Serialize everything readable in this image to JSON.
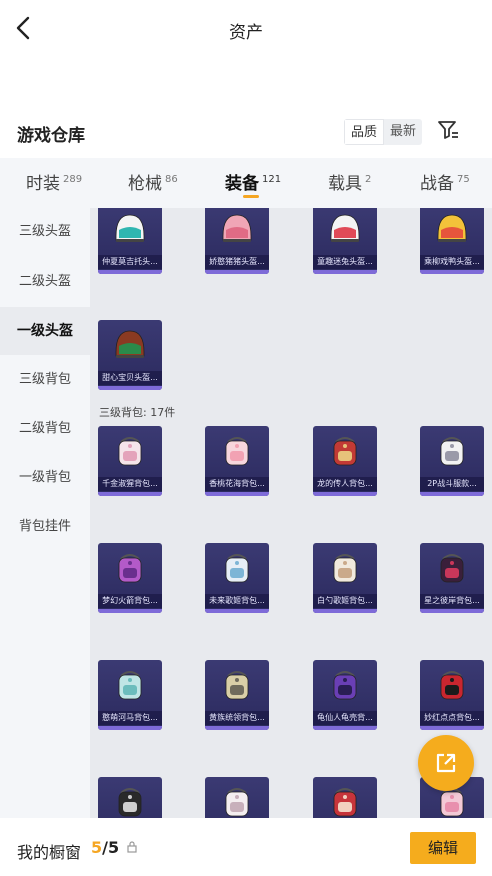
{
  "header": {
    "title": "资产"
  },
  "warehouse": {
    "title": "游戏仓库",
    "sort_options": [
      "品质",
      "最新"
    ]
  },
  "tabs": [
    {
      "label": "时装",
      "count": "289"
    },
    {
      "label": "枪械",
      "count": "86"
    },
    {
      "label": "装备",
      "count": "121"
    },
    {
      "label": "载具",
      "count": "2"
    },
    {
      "label": "战备",
      "count": "75"
    }
  ],
  "sidebar": {
    "items": [
      "三级头盔",
      "二级头盔",
      "一级头盔",
      "三级背包",
      "二级背包",
      "一级背包",
      "背包挂件"
    ]
  },
  "content": {
    "helmets": [
      {
        "name": "仲夏莫吉托头...",
        "icon": "helmet-mint-icon"
      },
      {
        "name": "娇憨猪猪头盔...",
        "icon": "helmet-pink-pig-icon"
      },
      {
        "name": "童趣迷兔头盔...",
        "icon": "helmet-bunny-icon"
      },
      {
        "name": "乘柳戏鸭头盔...",
        "icon": "helmet-duck-icon"
      },
      {
        "name": "甜心宝贝头盔...",
        "icon": "helmet-brown-icon"
      }
    ],
    "section_label": "三级背包: 17件",
    "backpacks": [
      {
        "name": "千金淑猩背包...",
        "icon": "backpack-pink-bow-icon"
      },
      {
        "name": "香桃花海背包...",
        "icon": "backpack-peach-icon"
      },
      {
        "name": "龙的传人背包...",
        "icon": "backpack-dragon-icon"
      },
      {
        "name": "2P战斗服款...",
        "icon": "backpack-white-icon"
      },
      {
        "name": "梦幻火箭背包...",
        "icon": "backpack-rocket-icon"
      },
      {
        "name": "未来歌姬背包...",
        "icon": "backpack-future-icon"
      },
      {
        "name": "白勺歌姬背包...",
        "icon": "backpack-cream-icon"
      },
      {
        "name": "星之彼岸背包...",
        "icon": "backpack-star-icon"
      },
      {
        "name": "憨萌河马背包...",
        "icon": "backpack-hippo-icon"
      },
      {
        "name": "黄族统领背包...",
        "icon": "backpack-gold-icon"
      },
      {
        "name": "龟仙人龟壳背...",
        "icon": "backpack-turtle-icon"
      },
      {
        "name": "妙红点点背包...",
        "icon": "backpack-ladybug-icon"
      },
      {
        "name": "",
        "icon": "backpack-black-icon"
      },
      {
        "name": "",
        "icon": "backpack-lace-icon"
      },
      {
        "name": "",
        "icon": "backpack-red-icon"
      },
      {
        "name": "",
        "icon": "backpack-pink-icon"
      }
    ]
  },
  "bottom": {
    "label": "我的橱窗",
    "count_current": "5",
    "count_total": "/5",
    "edit_label": "编辑"
  },
  "colors": {
    "accent": "#f5ac1d",
    "card_bg": "#3b3a73",
    "card_strip": "#7e6bd8"
  }
}
